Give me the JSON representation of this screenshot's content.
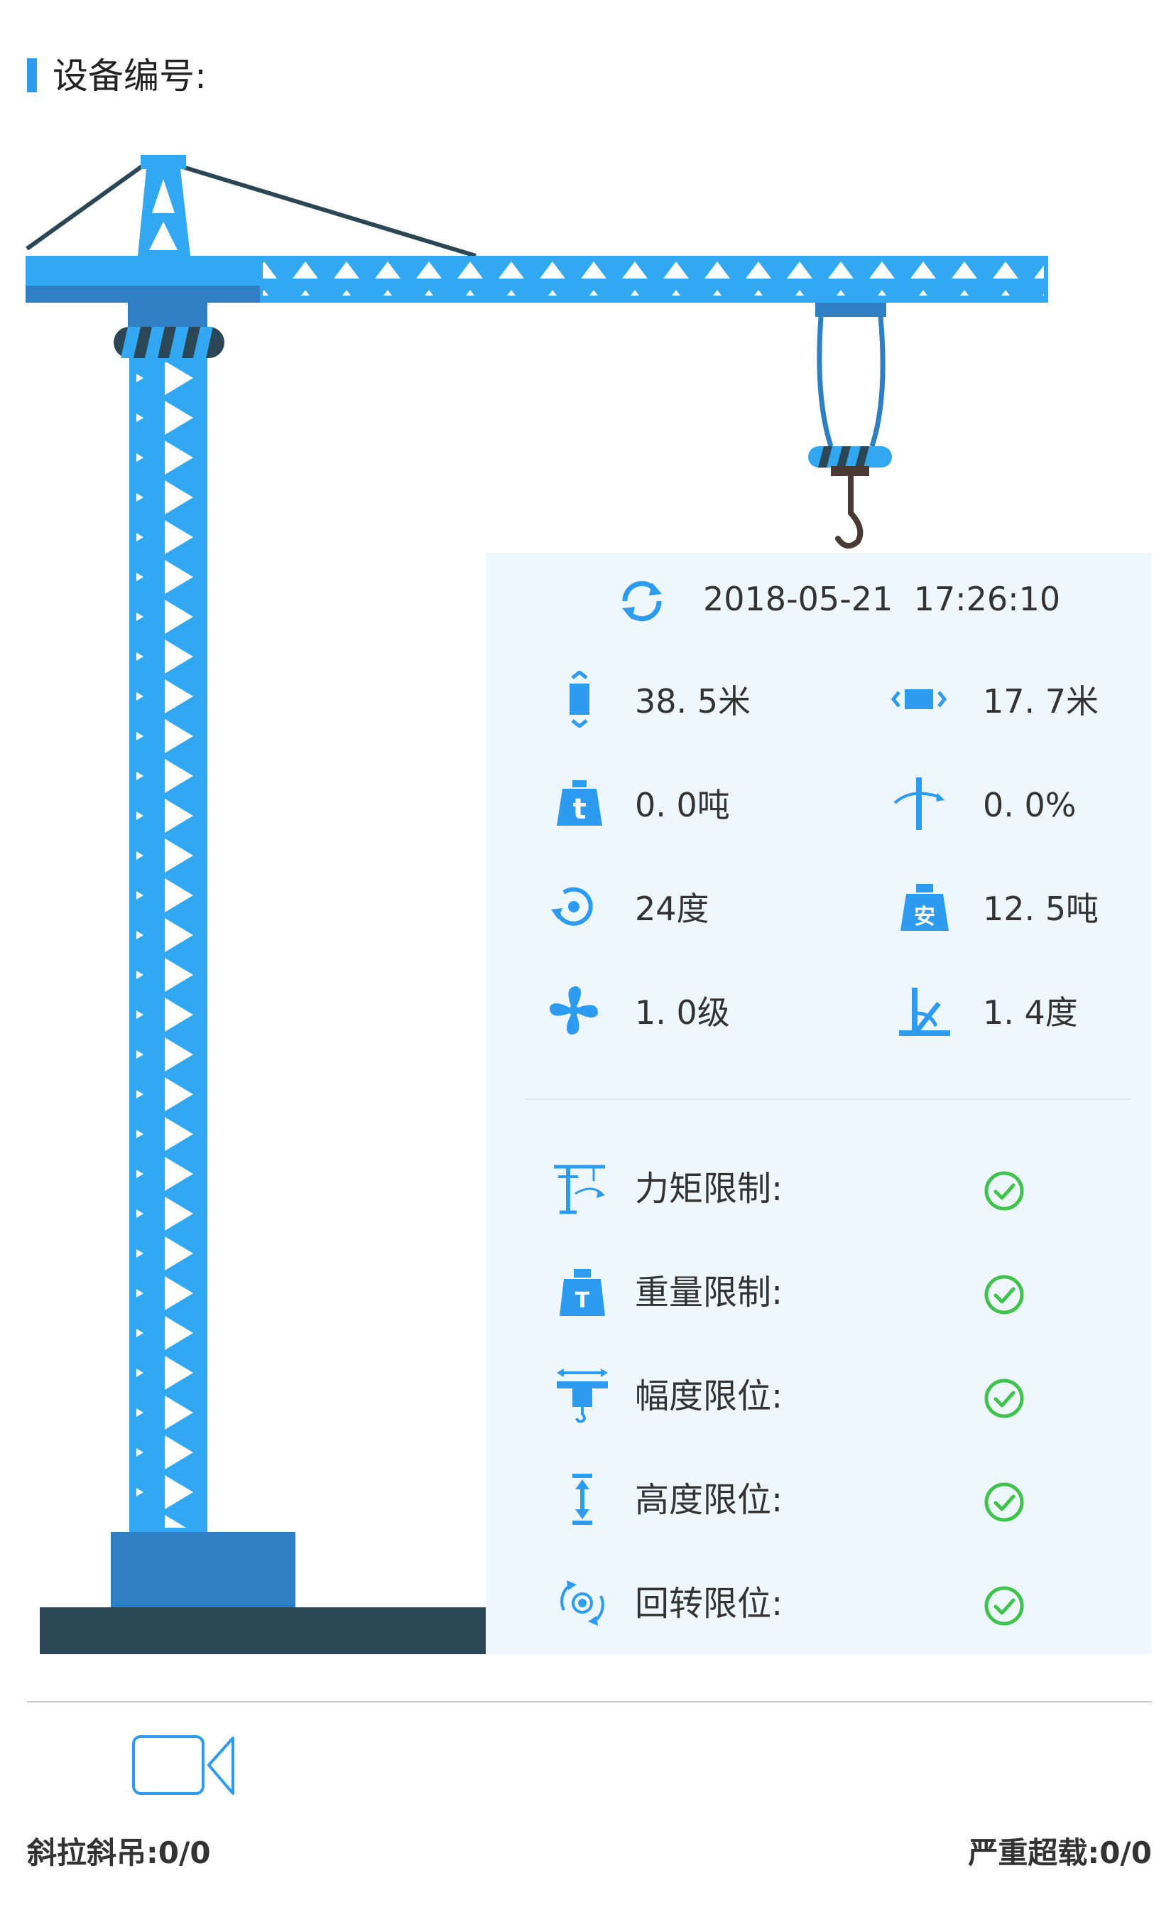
{
  "header": {
    "title": "设备编号:"
  },
  "timestamp": "2018-05-21  17:26:10",
  "metrics": [
    {
      "icon": "height-icon",
      "value": "38. 5米"
    },
    {
      "icon": "amplitude-icon",
      "value": "17. 7米"
    },
    {
      "icon": "weight-ton-icon",
      "value": "0. 0吨"
    },
    {
      "icon": "moment-percent-icon",
      "value": "0. 0%"
    },
    {
      "icon": "rotation-icon",
      "value": "24度"
    },
    {
      "icon": "safe-load-icon",
      "value": "12. 5吨"
    },
    {
      "icon": "wind-fan-icon",
      "value": "1. 0级"
    },
    {
      "icon": "tilt-angle-icon",
      "value": "1. 4度"
    }
  ],
  "limits": [
    {
      "icon": "moment-limit-icon",
      "label": "力矩限制:",
      "status": "ok"
    },
    {
      "icon": "weight-limit-icon",
      "label": "重量限制:",
      "status": "ok"
    },
    {
      "icon": "amplitude-limit-icon",
      "label": "幅度限位:",
      "status": "ok"
    },
    {
      "icon": "height-limit-icon",
      "label": "高度限位:",
      "status": "ok"
    },
    {
      "icon": "rotation-limit-icon",
      "label": "回转限位:",
      "status": "ok"
    }
  ],
  "footer": {
    "oblique_label": "斜拉斜吊:0/0",
    "overload_label": "严重超载:0/0"
  },
  "colors": {
    "accent": "#2d9bf0",
    "crane_blue": "#32a8f3",
    "crane_dark": "#2e7fc4",
    "base": "#2b4655",
    "ok_green": "#3fc34c",
    "panel_bg": "#eef7fe"
  }
}
